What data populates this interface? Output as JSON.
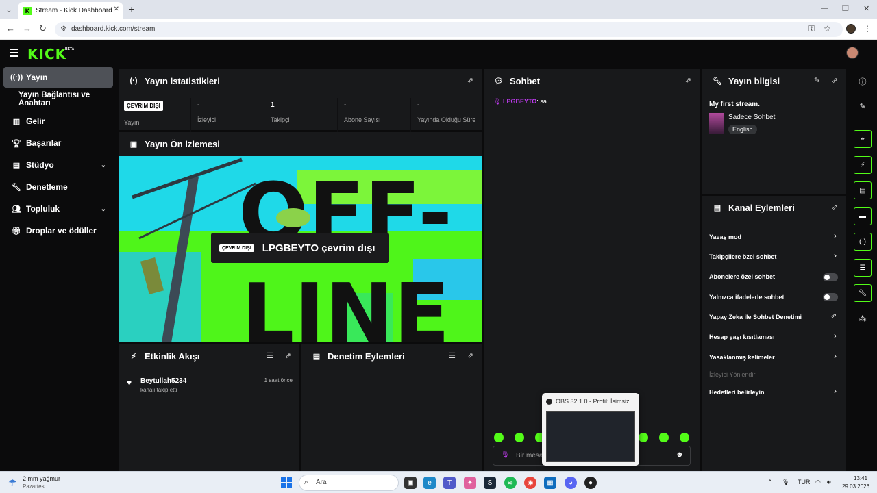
{
  "browser": {
    "tab_title": "Stream - Kick Dashboard",
    "url": "dashboard.kick.com/stream",
    "favicon_letter": "K"
  },
  "header": {
    "logo": "KICK",
    "beta": "BETA"
  },
  "sidebar": {
    "items": [
      {
        "label": "Yayın",
        "icon": "broadcast-icon"
      },
      {
        "label": "Yayın Bağlantısı ve Anahtarı",
        "icon": ""
      },
      {
        "label": "Gelir",
        "icon": "chart-icon"
      },
      {
        "label": "Başarılar",
        "icon": "trophy-icon"
      },
      {
        "label": "Stüdyo",
        "icon": "studio-icon"
      },
      {
        "label": "Denetleme",
        "icon": "wrench-icon"
      },
      {
        "label": "Topluluk",
        "icon": "people-icon"
      },
      {
        "label": "Droplar ve ödüller",
        "icon": "gift-icon"
      }
    ]
  },
  "stats": {
    "title": "Yayın İstatistikleri",
    "status_badge": "ÇEVRİM DIŞI",
    "items": [
      {
        "value": "",
        "label": "Yayın"
      },
      {
        "value": "-",
        "label": "İzleyici"
      },
      {
        "value": "1",
        "label": "Takipçi"
      },
      {
        "value": "-",
        "label": "Abone Sayısı"
      },
      {
        "value": "-",
        "label": "Yayında Olduğu Süre"
      }
    ]
  },
  "preview": {
    "title": "Yayın Ön İzlemesi",
    "badge": "ÇEVRİM DIŞI",
    "text": "LPGBEYTO çevrim dışı",
    "art_text_top": "OFF-",
    "art_text_bottom": "LINE"
  },
  "activity": {
    "title": "Etkinlik Akışı",
    "entries": [
      {
        "user": "Beytullah5234",
        "action": "kanalı takip etti",
        "time": "1 saat önce"
      }
    ]
  },
  "moderation": {
    "title": "Denetim Eylemleri"
  },
  "chat": {
    "title": "Sohbet",
    "messages": [
      {
        "user": "LPGBEYTO",
        "text": "sa"
      }
    ],
    "input_placeholder": "Bir mesa"
  },
  "info": {
    "title": "Yayın bilgisi",
    "stream_title": "My first stream.",
    "category": "Sadece Sohbet",
    "language": "English"
  },
  "channel_actions": {
    "title": "Kanal Eylemleri",
    "items": [
      {
        "label": "Yavaş mod",
        "control": "chevron"
      },
      {
        "label": "Takipçilere özel sohbet",
        "control": "chevron"
      },
      {
        "label": "Abonelere özel sohbet",
        "control": "toggle"
      },
      {
        "label": "Yalnızca ifadelerle sohbet",
        "control": "toggle"
      },
      {
        "label": "Yapay Zeka ile Sohbet Denetimi",
        "control": "external"
      },
      {
        "label": "Hesap yaşı kısıtlaması",
        "control": "chevron"
      },
      {
        "label": "Yasaklanmış kelimeler",
        "control": "chevron"
      },
      {
        "label": "İzleyici Yönlendir",
        "control": "disabled"
      },
      {
        "label": "Hedefleri belirleyin",
        "control": "chevron"
      }
    ]
  },
  "obs_tooltip": {
    "title": "OBS 32.1.0 - Profil: İsimsiz..."
  },
  "taskbar": {
    "weather_line1": "2 mm yağmur",
    "weather_line2": "Pazartesi",
    "search_placeholder": "Ara",
    "language": "TUR",
    "time": "13:41",
    "date": "29.03.2026"
  },
  "colors": {
    "accent": "#53fc18",
    "panel": "#18191b",
    "bg": "#0b0b0c",
    "chat_user": "#c23cf3"
  }
}
